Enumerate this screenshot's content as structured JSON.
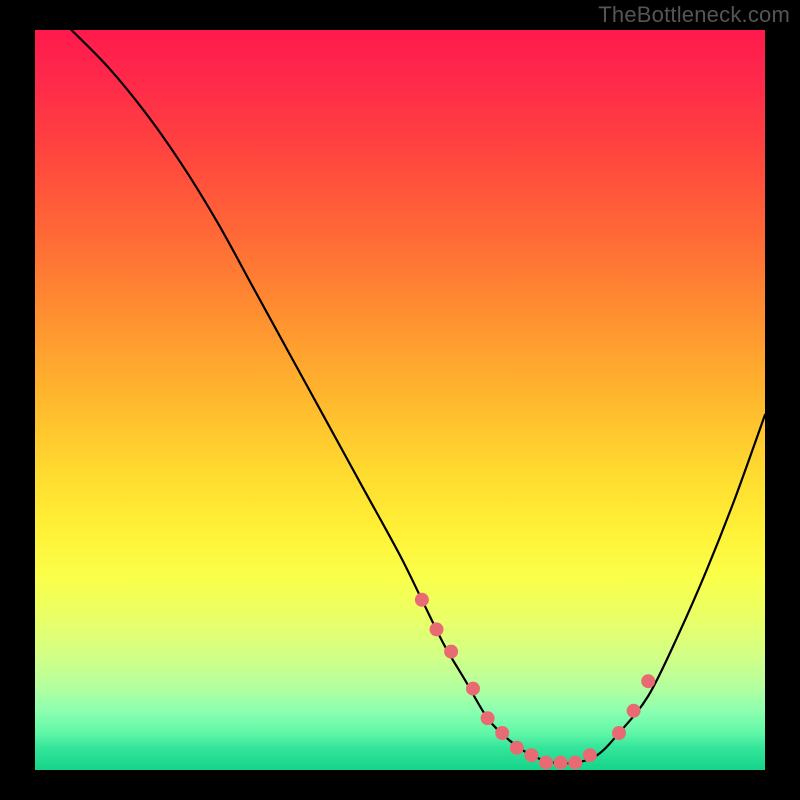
{
  "attribution": "TheBottleneck.com",
  "chart_data": {
    "type": "line",
    "title": "",
    "xlabel": "",
    "ylabel": "",
    "xlim": [
      0,
      100
    ],
    "ylim": [
      0,
      100
    ],
    "grid": false,
    "series": [
      {
        "name": "bottleneck-curve",
        "x": [
          5,
          10,
          15,
          20,
          25,
          30,
          35,
          40,
          45,
          50,
          53,
          56,
          59,
          62,
          65,
          68,
          71,
          74,
          77,
          80,
          84,
          88,
          92,
          96,
          100
        ],
        "y": [
          100,
          95,
          89,
          82,
          74,
          65,
          56,
          47,
          38,
          29,
          23,
          17,
          12,
          7,
          4,
          2,
          1,
          1,
          2,
          5,
          10,
          18,
          27,
          37,
          48
        ]
      }
    ],
    "markers": {
      "name": "highlight-dots",
      "x": [
        53,
        55,
        57,
        60,
        62,
        64,
        66,
        68,
        70,
        72,
        74,
        76,
        80,
        82,
        84
      ],
      "y": [
        23,
        19,
        16,
        11,
        7,
        5,
        3,
        2,
        1,
        1,
        1,
        2,
        5,
        8,
        12
      ]
    },
    "background_gradient": {
      "top": "#ff1a4d",
      "mid": "#ffe838",
      "bottom": "#14d48b"
    }
  }
}
